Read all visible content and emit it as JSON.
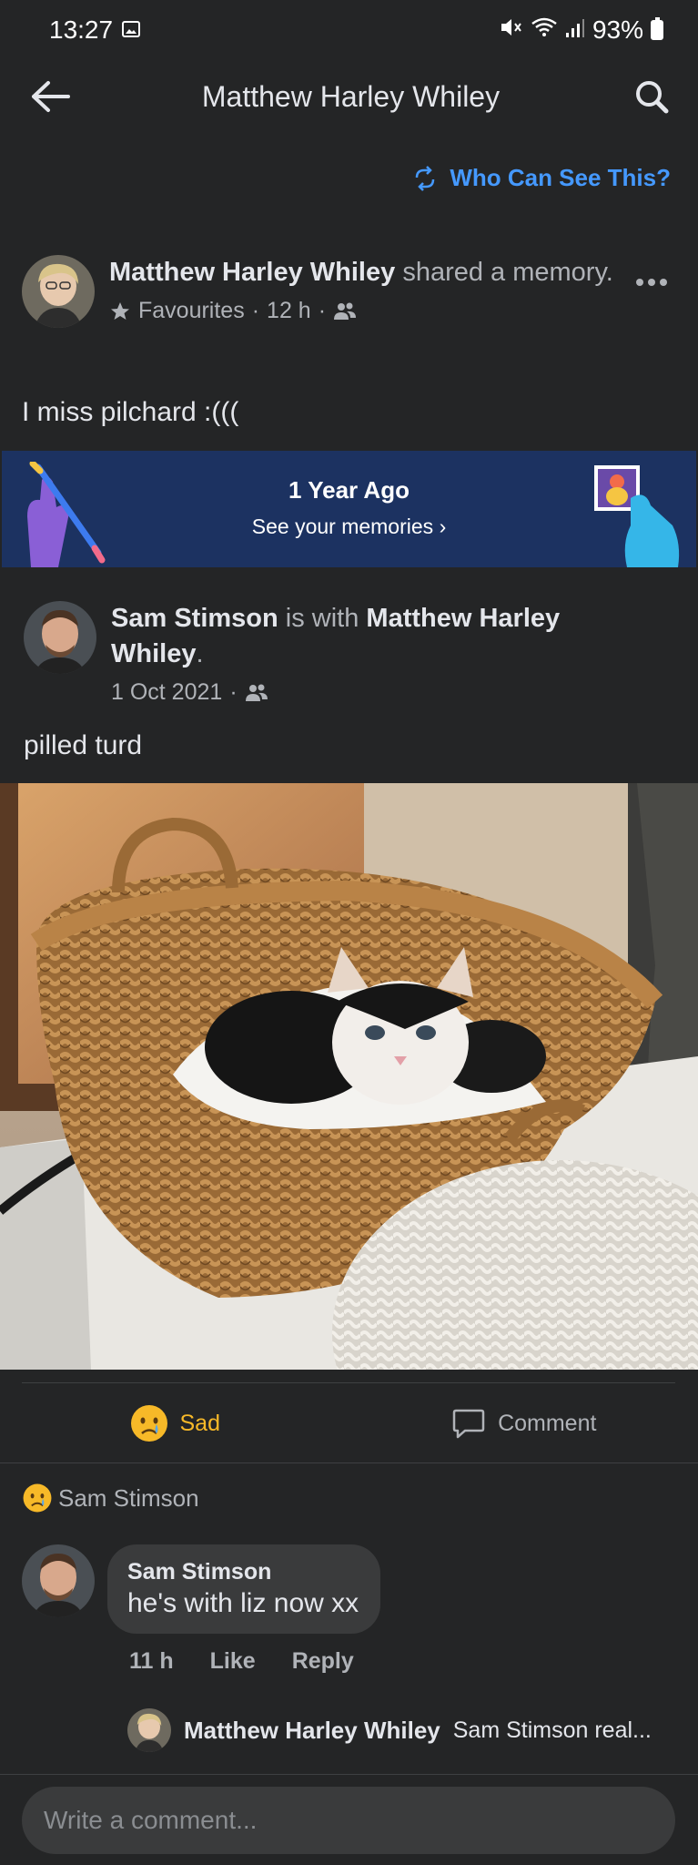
{
  "status_bar": {
    "time": "13:27",
    "battery": "93%"
  },
  "header": {
    "title": "Matthew Harley Whiley"
  },
  "privacy": {
    "label": "Who Can See This?"
  },
  "post": {
    "author": "Matthew Harley Whiley",
    "action_text": "shared a memory.",
    "audience": "Favourites",
    "time": "12 h",
    "body": "I miss pilchard :((("
  },
  "memories": {
    "title": "1 Year Ago",
    "subtitle": "See your memories"
  },
  "shared_post": {
    "author": "Sam Stimson",
    "with_text": "is with",
    "tagged": "Matthew Harley Whiley",
    "date": "1 Oct 2021",
    "body": "pilled turd"
  },
  "actions": {
    "reaction_label": "Sad",
    "comment_label": "Comment"
  },
  "reactions": {
    "reactor": "Sam Stimson"
  },
  "comment": {
    "author": "Sam Stimson",
    "text": "he's with liz now xx",
    "time": "11 h",
    "like_label": "Like",
    "reply_label": "Reply"
  },
  "reply": {
    "author": "Matthew Harley Whiley",
    "preview": "Sam Stimson real..."
  },
  "composer": {
    "placeholder": "Write a comment..."
  },
  "colors": {
    "background": "#242526",
    "link": "#4599ff",
    "sad": "#f7b928",
    "banner": "#1c3261"
  }
}
